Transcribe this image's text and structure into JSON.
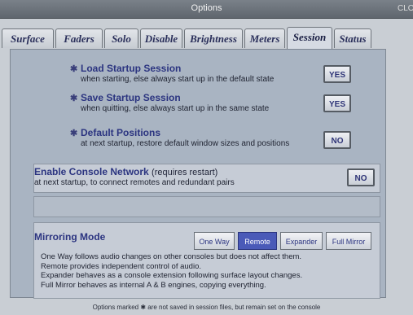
{
  "window": {
    "title": "Options",
    "close_label": "CLOSE"
  },
  "tabs": [
    {
      "label": "Surface",
      "active": false
    },
    {
      "label": "Faders",
      "active": false
    },
    {
      "label": "Solo",
      "active": false
    },
    {
      "label": "Disable",
      "active": false
    },
    {
      "label": "Brightness",
      "active": false
    },
    {
      "label": "Meters",
      "active": false
    },
    {
      "label": "Session",
      "active": true
    },
    {
      "label": "Status",
      "active": false
    }
  ],
  "options": {
    "load_startup": {
      "star": "✱",
      "title": "Load Startup Session",
      "desc": "when starting, else always start up in the default state",
      "value": "YES"
    },
    "save_startup": {
      "star": "✱",
      "title": "Save Startup Session",
      "desc": "when quitting, else always start up in the same state",
      "value": "YES"
    },
    "default_positions": {
      "star": "✱",
      "title": "Default Positions",
      "desc": "at next startup, restore default window sizes and positions",
      "value": "NO"
    },
    "console_network": {
      "star": "✱",
      "title": "Enable Console Network",
      "note": "(requires restart)",
      "desc": "at next startup, to connect remotes and redundant pairs",
      "value": "NO"
    }
  },
  "mirroring": {
    "star": "✱",
    "title": "Mirroring Mode",
    "modes": [
      {
        "label": "One Way",
        "active": false
      },
      {
        "label": "Remote",
        "active": true
      },
      {
        "label": "Expander",
        "active": false
      },
      {
        "label": "Full Mirror",
        "active": false
      }
    ],
    "desc": [
      "One Way follows audio changes on other consoles but does not affect them.",
      "Remote provides independent control of audio.",
      "Expander behaves as a console extension following surface layout changes.",
      "Full Mirror behaves as internal A & B engines, copying everything."
    ]
  },
  "footer": "Options marked ✱ are not saved in session files, but remain set on the console",
  "colors": {
    "accent": "#2b3480",
    "active_mode": "#4a5ab8",
    "panel": "#a9b4c2"
  }
}
